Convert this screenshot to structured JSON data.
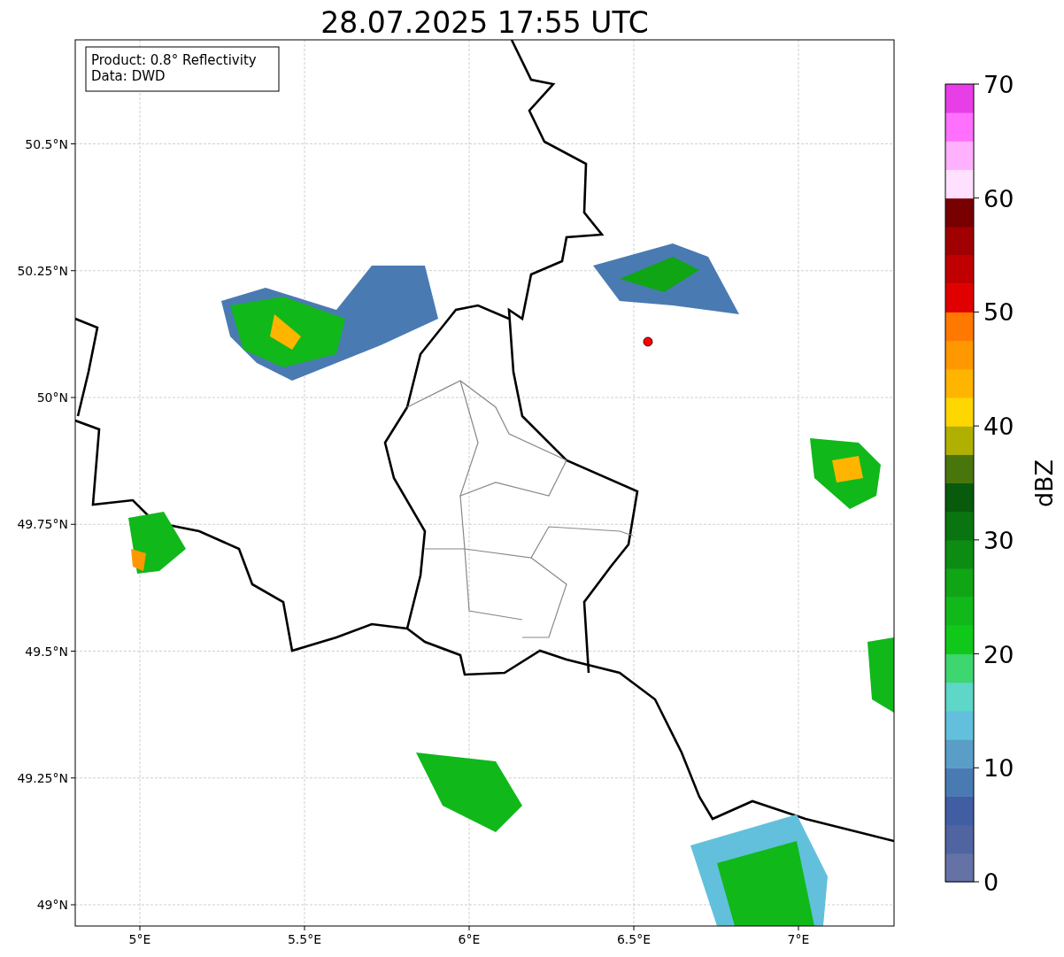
{
  "title": "28.07.2025 17:55 UTC",
  "annotation": [
    "Product: 0.8° Reflectivity",
    "Data: DWD"
  ],
  "map": {
    "xticks": [
      "5°E",
      "5.5°E",
      "6°E",
      "6.5°E",
      "7°E"
    ],
    "yticks": [
      "50.5°N",
      "50.25°N",
      "50°N",
      "49.75°N",
      "49.5°N",
      "49.25°N",
      "49°N"
    ]
  },
  "colorbar": {
    "label": "dBZ",
    "ticks": [
      "70",
      "60",
      "50",
      "40",
      "30",
      "20",
      "10",
      "0"
    ],
    "bins": [
      {
        "color": "#6472a6"
      },
      {
        "color": "#4f64a0"
      },
      {
        "color": "#415ea3"
      },
      {
        "color": "#4a7ab2"
      },
      {
        "color": "#5a9ec8"
      },
      {
        "color": "#62c0dc"
      },
      {
        "color": "#5ed6c8"
      },
      {
        "color": "#3ed670"
      },
      {
        "color": "#10c81a"
      },
      {
        "color": "#10b81a"
      },
      {
        "color": "#0fa514"
      },
      {
        "color": "#0c8c12"
      },
      {
        "color": "#0a7510"
      },
      {
        "color": "#085a0c"
      },
      {
        "color": "#48760c"
      },
      {
        "color": "#b0b000"
      },
      {
        "color": "#ffd700"
      },
      {
        "color": "#ffb400"
      },
      {
        "color": "#ff9800"
      },
      {
        "color": "#ff7800"
      },
      {
        "color": "#e00000"
      },
      {
        "color": "#c00000"
      },
      {
        "color": "#a00000"
      },
      {
        "color": "#780000"
      },
      {
        "color": "#ffe0ff"
      },
      {
        "color": "#ffb0ff"
      },
      {
        "color": "#ff70ff"
      },
      {
        "color": "#e83ee8"
      }
    ]
  }
}
